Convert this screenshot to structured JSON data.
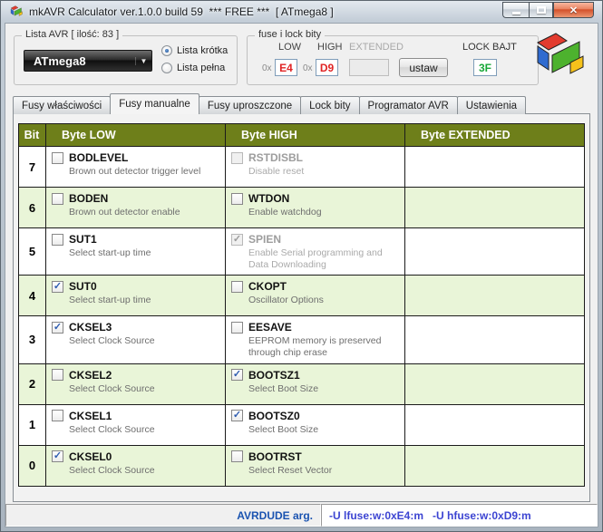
{
  "window": {
    "title": "mkAVR Calculator ver.1.0.0 build 59  *** FREE ***  [ ATmega8 ]"
  },
  "top": {
    "avr_group": {
      "label": "Lista AVR [ ilość: 83 ]",
      "combo_value": "ATmega8",
      "radio_short": "Lista krótka",
      "radio_full": "Lista pełna"
    },
    "fuse_group": {
      "label": "fuse i lock bity",
      "low_label": "LOW",
      "high_label": "HIGH",
      "extended_label": "EXTENDED",
      "hex_prefix": "0x",
      "low_value": "E4",
      "high_value": "D9",
      "extended_value": "",
      "set_button": "ustaw",
      "lock_label": "LOCK BAJT",
      "lock_value": "3F"
    }
  },
  "tabs": {
    "active_index": 1,
    "items": [
      "Fusy właściwości",
      "Fusy manualne",
      "Fusy uproszczone",
      "Lock bity",
      "Programator AVR",
      "Ustawienia"
    ]
  },
  "table": {
    "headers": [
      "Bit",
      "Byte LOW",
      "Byte HIGH",
      "Byte EXTENDED"
    ],
    "rows": [
      {
        "bit": "7",
        "low": {
          "name": "BODLEVEL",
          "desc": "Brown out detector trigger level",
          "checked": false,
          "disabled": false
        },
        "high": {
          "name": "RSTDISBL",
          "desc": "Disable reset",
          "checked": false,
          "disabled": true
        },
        "ext": null
      },
      {
        "bit": "6",
        "low": {
          "name": "BODEN",
          "desc": "Brown out detector enable",
          "checked": false,
          "disabled": false
        },
        "high": {
          "name": "WTDON",
          "desc": "Enable watchdog",
          "checked": false,
          "disabled": false
        },
        "ext": null
      },
      {
        "bit": "5",
        "low": {
          "name": "SUT1",
          "desc": "Select start-up time",
          "checked": false,
          "disabled": false
        },
        "high": {
          "name": "SPIEN",
          "desc": "Enable Serial programming and Data Downloading",
          "checked": true,
          "disabled": true
        },
        "ext": null
      },
      {
        "bit": "4",
        "low": {
          "name": "SUT0",
          "desc": "Select start-up time",
          "checked": true,
          "disabled": false
        },
        "high": {
          "name": "CKOPT",
          "desc": "Oscillator Options",
          "checked": false,
          "disabled": false
        },
        "ext": null
      },
      {
        "bit": "3",
        "low": {
          "name": "CKSEL3",
          "desc": "Select Clock Source",
          "checked": true,
          "disabled": false
        },
        "high": {
          "name": "EESAVE",
          "desc": "EEPROM memory is preserved through chip erase",
          "checked": false,
          "disabled": false
        },
        "ext": null
      },
      {
        "bit": "2",
        "low": {
          "name": "CKSEL2",
          "desc": "Select Clock Source",
          "checked": false,
          "disabled": false
        },
        "high": {
          "name": "BOOTSZ1",
          "desc": "Select Boot Size",
          "checked": true,
          "disabled": false
        },
        "ext": null
      },
      {
        "bit": "1",
        "low": {
          "name": "CKSEL1",
          "desc": "Select Clock Source",
          "checked": false,
          "disabled": false
        },
        "high": {
          "name": "BOOTSZ0",
          "desc": "Select Boot Size",
          "checked": true,
          "disabled": false
        },
        "ext": null
      },
      {
        "bit": "0",
        "low": {
          "name": "CKSEL0",
          "desc": "Select Clock Source",
          "checked": true,
          "disabled": false
        },
        "high": {
          "name": "BOOTRST",
          "desc": "Select Reset Vector",
          "checked": false,
          "disabled": false
        },
        "ext": null
      }
    ]
  },
  "statusbar": {
    "label": "AVRDUDE arg.",
    "args": "-U lfuse:w:0xE4:m   -U hfuse:w:0xD9:m"
  },
  "colors": {
    "header_green": "#6e7f1a",
    "row_green": "#e9f5d8",
    "value_red": "#e02425",
    "lock_green": "#18a838",
    "status_blue": "#1a53b0",
    "args_blue": "#3c44d2"
  }
}
